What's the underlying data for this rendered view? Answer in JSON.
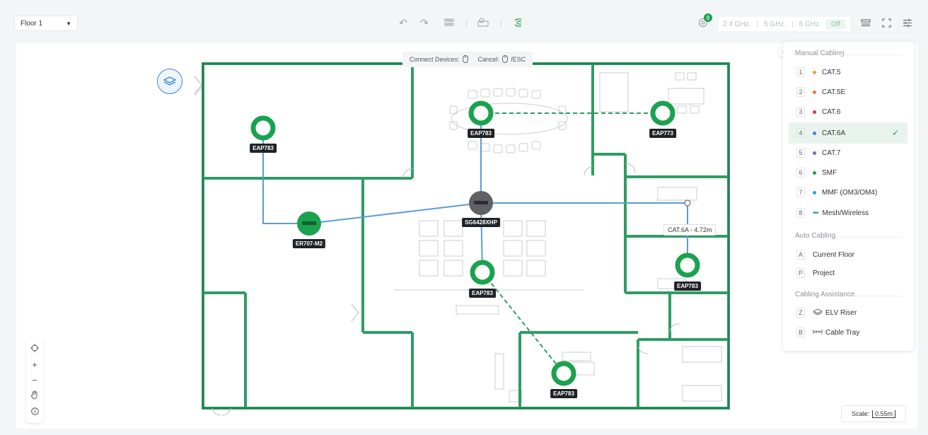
{
  "toolbar": {
    "floor_select": "Floor 1",
    "notification_count": "8",
    "bands": [
      "2.4 GHz.",
      "5 GHz.",
      "6 GHz."
    ],
    "off_label": "Off"
  },
  "hint": {
    "connect": "Connect Devices:",
    "cancel": "Cancel:",
    "esc": "/ESC"
  },
  "devices": [
    {
      "label": "EAP783"
    },
    {
      "label": "EAP783"
    },
    {
      "label": "EAP773"
    },
    {
      "label": "SG6428XHP"
    },
    {
      "label": "ER707-M2"
    },
    {
      "label": "EAP783"
    },
    {
      "label": "EAP783"
    },
    {
      "label": "EAP783"
    }
  ],
  "cable_tooltip": "CAT.6A - 4.72m",
  "scale": {
    "label": "Scale:",
    "value": "0.55m"
  },
  "panel": {
    "manual_title": "Manual Cabling",
    "manual_items": [
      {
        "key": "1",
        "label": "CAT.5",
        "color": "#f0a030"
      },
      {
        "key": "2",
        "label": "CAT.5E",
        "color": "#f07a30"
      },
      {
        "key": "3",
        "label": "CAT.6",
        "color": "#d93a3a"
      },
      {
        "key": "4",
        "label": "CAT.6A",
        "color": "#3b84d4"
      },
      {
        "key": "5",
        "label": "CAT.7",
        "color": "#8a5cc8"
      },
      {
        "key": "6",
        "label": "SMF",
        "color": "#1aa24f"
      },
      {
        "key": "7",
        "label": "MMF (OM3/OM4)",
        "color": "#2aa0d8"
      },
      {
        "key": "8",
        "label": "Mesh/Wireless",
        "color": "#2e9d63"
      }
    ],
    "auto_title": "Auto Cabling",
    "auto_items": [
      {
        "key": "A",
        "label": "Current Floor"
      },
      {
        "key": "P",
        "label": "Project"
      }
    ],
    "assist_title": "Cabling Assistance",
    "assist_items": [
      {
        "key": "Z",
        "label": "ELV Riser"
      },
      {
        "key": "B",
        "label": "Cable Tray"
      }
    ]
  }
}
